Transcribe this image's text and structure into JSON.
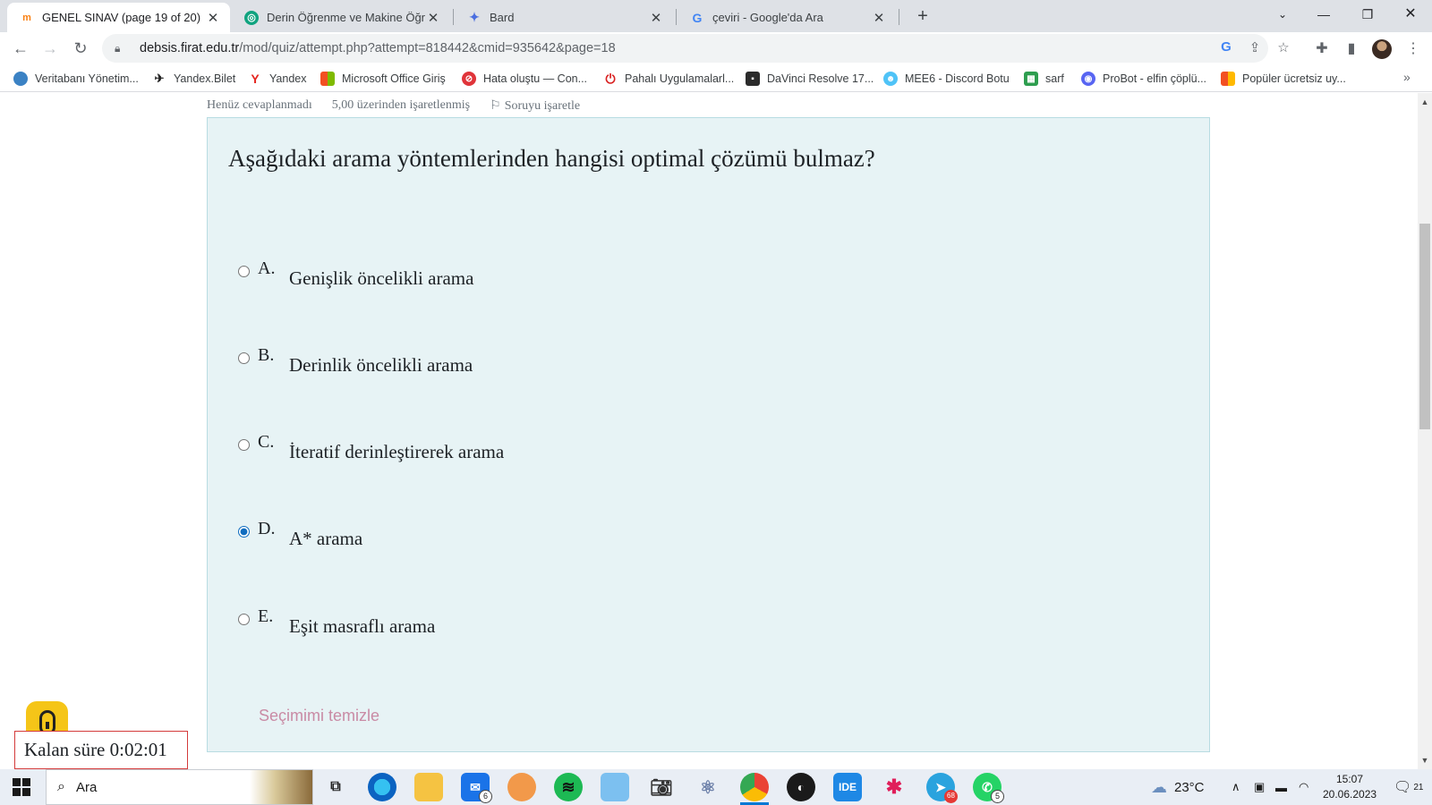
{
  "browser": {
    "tabs": [
      {
        "title": "GENEL SINAV (page 19 of 20)",
        "active": true,
        "favicon": "moodle-icon"
      },
      {
        "title": "Derin Öğrenme ve Makine Öğrenmesi",
        "active": false,
        "favicon": "chatgpt-icon"
      },
      {
        "title": "Bard",
        "active": false,
        "favicon": "bard-icon"
      },
      {
        "title": "çeviri - Google'da Ara",
        "active": false,
        "favicon": "google-icon"
      }
    ],
    "address": {
      "host": "debsis.firat.edu.tr",
      "path": "/mod/quiz/attempt.php?attempt=818442&cmid=935642&page=18"
    },
    "bookmarks": [
      {
        "label": "Veritabanı Yönetim...",
        "color": "#3b82c4"
      },
      {
        "label": "Yandex.Bilet",
        "color": "#222222"
      },
      {
        "label": "Yandex",
        "color": "#e52620"
      },
      {
        "label": "Microsoft Office Giriş",
        "color": "#f25022"
      },
      {
        "label": "Hata oluştu — Con...",
        "color": "#e0343a"
      },
      {
        "label": "Pahalı Uygulamalarl...",
        "color": "#d92121"
      },
      {
        "label": "DaVinci Resolve 17...",
        "color": "#2b2b2b"
      },
      {
        "label": "MEE6 - Discord Botu",
        "color": "#4fc3f7"
      },
      {
        "label": "sarf",
        "color": "#2e9e4f"
      },
      {
        "label": "ProBot - elfin çöplü...",
        "color": "#5865f2"
      },
      {
        "label": "Popüler ücretsiz uy...",
        "color": "#f25022"
      }
    ]
  },
  "quiz": {
    "status": "Henüz cevaplanmadı",
    "mark": "5,00 üzerinden işaretlenmiş",
    "flag_label": "Soruyu işaretle",
    "question": "Aşağıdaki arama yöntemlerinden hangisi optimal çözümü bulmaz?",
    "answers": [
      {
        "letter": "A.",
        "text": "Genişlik öncelikli arama",
        "selected": false
      },
      {
        "letter": "B.",
        "text": "Derinlik öncelikli arama",
        "selected": false
      },
      {
        "letter": "C.",
        "text": "İteratif derinleştirerek arama",
        "selected": false
      },
      {
        "letter": "D.",
        "text": "A* arama",
        "selected": true
      },
      {
        "letter": "E.",
        "text": "Eşit masraflı arama",
        "selected": false
      }
    ],
    "clear_label": "Seçimimi temizle",
    "timer": "Kalan süre 0:02:01"
  },
  "taskbar": {
    "search_placeholder": "Ara",
    "mail_badge": "6",
    "telegram_badge": "68",
    "whatsapp_badge": "5",
    "ide_label": "IDE",
    "weather": "23°C",
    "time": "15:07",
    "date": "20.06.2023",
    "notifications": "21"
  }
}
